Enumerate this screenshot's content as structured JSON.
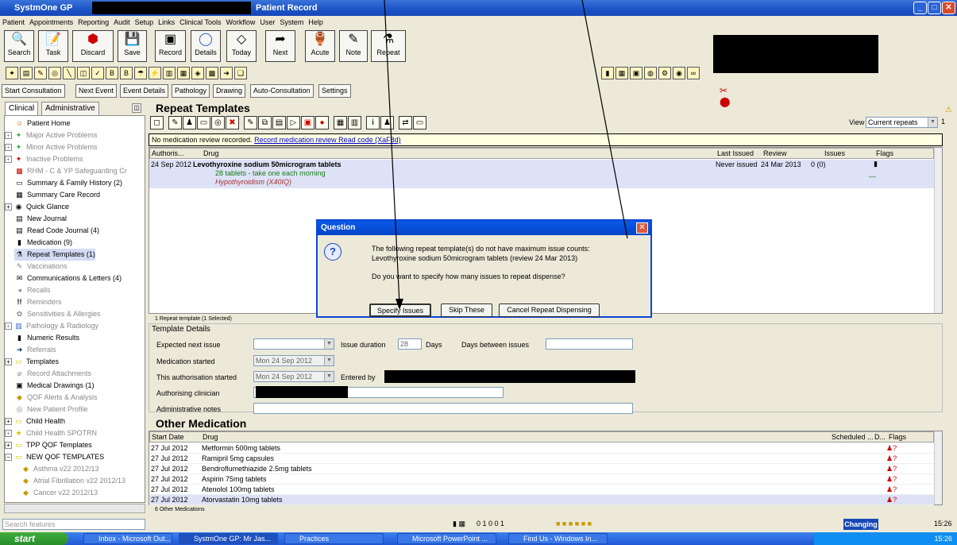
{
  "window": {
    "title_left": "SystmOne GP",
    "title_right": "Patient Record"
  },
  "menu": [
    "Patient",
    "Appointments",
    "Reporting",
    "Audit",
    "Setup",
    "Links",
    "Clinical Tools",
    "Workflow",
    "User",
    "System",
    "Help"
  ],
  "toolbar": [
    {
      "label": "Search",
      "icon": "magnifier-icon"
    },
    {
      "label": "Task",
      "icon": "task-icon"
    },
    {
      "label": "Discard",
      "icon": "discard-icon"
    },
    {
      "label": "Save",
      "icon": "save-icon"
    },
    {
      "label": "Record",
      "icon": "record-icon"
    },
    {
      "label": "Details",
      "icon": "details-icon"
    },
    {
      "label": "Today",
      "icon": "today-icon"
    },
    {
      "label": "Next",
      "icon": "next-icon"
    },
    {
      "label": "Acute",
      "icon": "acute-icon"
    },
    {
      "label": "Note",
      "icon": "note-icon"
    },
    {
      "label": "Repeat",
      "icon": "repeat-icon"
    }
  ],
  "consult_buttons": [
    "Start Consultation",
    "Next Event",
    "Event Details",
    "Pathology",
    "Drawing",
    "Auto-Consultation",
    "Settings"
  ],
  "tabs": {
    "clinical": "Clinical",
    "administrative": "Administrative"
  },
  "tree": [
    "Patient Home",
    "Major Active Problems",
    "Minor Active Problems",
    "Inactive Problems",
    "RHM - C & YP Safeguarding Cr",
    "Summary & Family History (2)",
    "Summary Care Record",
    "Quick Glance",
    "New Journal",
    "Read Code Journal (4)",
    "Medication (9)",
    "Repeat Templates (1)",
    "Vaccinations",
    "Communications & Letters (4)",
    "Recalls",
    "Reminders",
    "Sensitivities & Allergies",
    "Pathology & Radiology",
    "Numeric Results",
    "Referrals",
    "Templates",
    "Record Attachments",
    "Medical Drawings (1)",
    "QOF Alerts & Analysis",
    "New Patient Profile",
    "Child Health",
    "Child Health SPOTRN",
    "TPP QOF Templates",
    "NEW QOF TEMPLATES",
    "Asthma v22 2012/13",
    "Atrial Fibrillation v22 2012/13",
    "Cancer v22 2012/13"
  ],
  "repeat": {
    "heading": "Repeat Templates",
    "view_label": "View",
    "view_value": "Current repeats",
    "page_num": "1",
    "notice_text": "No medication review recorded.",
    "notice_link": "Record medication review Read code (XaF8d)",
    "columns": {
      "auth": "Authoris...",
      "drug": "Drug",
      "last": "Last Issued",
      "review": "Review",
      "issues": "Issues",
      "flags": "Flags"
    },
    "row": {
      "date": "24 Sep 2012",
      "drug": "Levothyroxine sodium 50microgram tablets",
      "dose": "28 tablets - take one each morning",
      "indication": "Hypothyroidism (X40IQ)",
      "last": "Never issued",
      "review": "24 Mar 2013",
      "issues": "0 (0)"
    },
    "count_text": "1 Repeat template (1 Selected)"
  },
  "details": {
    "legend": "Template Details",
    "expected_label": "Expected next issue",
    "expected_value": "",
    "duration_label": "Issue duration",
    "duration_value": "28",
    "days_label": "Days",
    "between_label": "Days between issues",
    "between_value": "",
    "med_started_label": "Medication started",
    "med_started_value": "Mon 24 Sep 2012",
    "auth_started_label": "This authorisation started",
    "auth_started_value": "Mon 24 Sep 2012",
    "entered_label": "Entered by",
    "clinician_label": "Authorising clinician",
    "notes_label": "Administrative notes"
  },
  "other": {
    "heading": "Other Medication",
    "columns": {
      "date": "Start Date",
      "drug": "Drug",
      "scheduled": "Scheduled ...",
      "d": "D...",
      "flags": "Flags"
    },
    "rows": [
      {
        "date": "27 Jul 2012",
        "drug": "Metformin 500mg tablets"
      },
      {
        "date": "27 Jul 2012",
        "drug": "Ramipril 5mg capsules"
      },
      {
        "date": "27 Jul 2012",
        "drug": "Bendroflumethiazide 2.5mg tablets"
      },
      {
        "date": "27 Jul 2012",
        "drug": "Aspirin 75mg tablets"
      },
      {
        "date": "27 Jul 2012",
        "drug": "Atenolol 100mg tablets"
      },
      {
        "date": "27 Jul 2012",
        "drug": "Atorvastatin 10mg tablets"
      }
    ],
    "count_text": "6 Other Medications"
  },
  "dialog": {
    "title": "Question",
    "line1": "The following repeat template(s) do not have maximum issue counts:",
    "line2": "Levothyroxine sodium 50microgram tablets (review 24 Mar 2013)",
    "line3": "Do you want to specify how many issues to repeat dispense?",
    "btn_specify": "Specify Issues",
    "btn_skip": "Skip These",
    "btn_cancel": "Cancel Repeat Dispensing"
  },
  "status": {
    "search_placeholder": "Search features",
    "counters": "0 1 0 0 1",
    "changing": "Changing",
    "time": "15:26"
  },
  "taskbar": {
    "start": "start",
    "items": [
      "Inbox - Microsoft Out...",
      "SystmOne GP: Mr Jas...",
      "Practices",
      "Microsoft PowerPoint ...",
      "Find Us - Windows In..."
    ],
    "time": "15:26"
  }
}
